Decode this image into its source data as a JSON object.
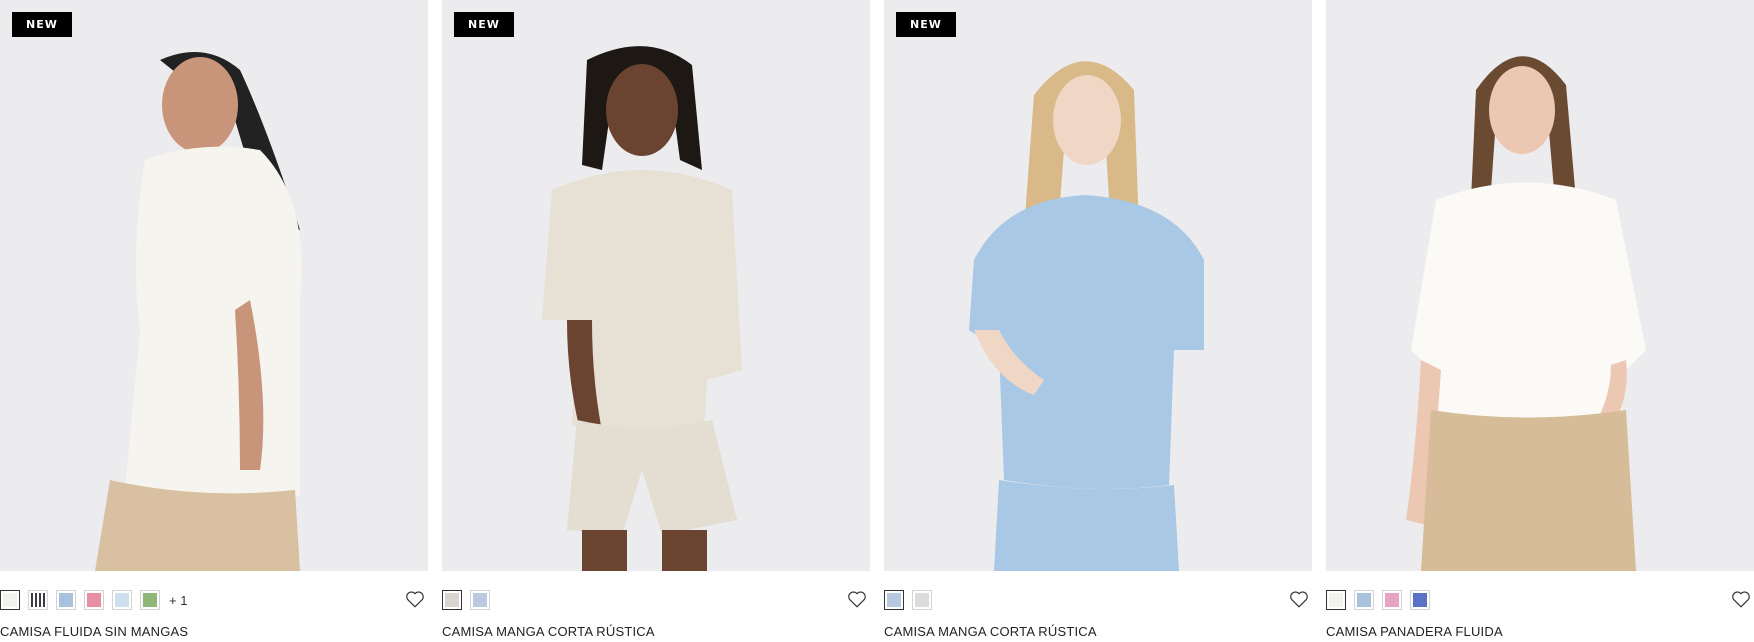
{
  "products": [
    {
      "badge": "NEW",
      "title": "CAMISA FLUIDA SIN MANGAS",
      "more_colors": "+ 1",
      "swatches": [
        "#f3f2ee",
        "#3b3b4a",
        "#a8c2de",
        "#e88fa6",
        "#cfdff0",
        "#8fb77a"
      ],
      "garment_color": "#f5f4ef",
      "bottom_color": "#d9c0a0",
      "hair_color": "#222222"
    },
    {
      "badge": "NEW",
      "title": "CAMISA MANGA CORTA RÚSTICA",
      "swatches": [
        "#d8d5d0",
        "#b9c9df"
      ],
      "garment_color": "#e6e0d5",
      "bottom_color": "#e3ddd2",
      "hair_color": "#1d1813"
    },
    {
      "badge": "NEW",
      "title": "CAMISA MANGA CORTA RÚSTICA",
      "swatches": [
        "#b5c8df",
        "#dcdcda"
      ],
      "garment_color": "#a9c8e6",
      "bottom_color": "#a9c8e6",
      "hair_color": "#d8b987"
    },
    {
      "badge": "",
      "title": "CAMISA PANADERA FLUIDA",
      "swatches": [
        "#f3f2ee",
        "#a8c2de",
        "#e8a4c4",
        "#5a73c8"
      ],
      "garment_color": "#fbfaf6",
      "bottom_color": "#d6bc98",
      "hair_color": "#6b4a32"
    }
  ],
  "icons": {
    "favorite": "heart-outline-icon"
  }
}
